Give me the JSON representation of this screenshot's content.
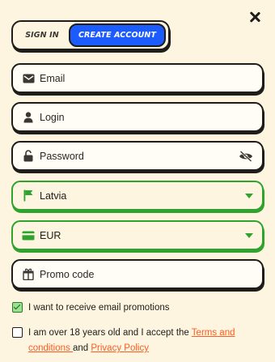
{
  "tabs": {
    "sign_in": "SIGN IN",
    "create_account": "CREATE ACCOUNT",
    "active": "create_account"
  },
  "fields": {
    "email": {
      "placeholder": "Email",
      "icon": "envelope-icon"
    },
    "login": {
      "placeholder": "Login",
      "icon": "user-icon"
    },
    "password": {
      "placeholder": "Password",
      "icon": "lock-icon",
      "toggle_icon": "eye-off-icon"
    },
    "country": {
      "value": "Latvia",
      "icon": "flag-icon"
    },
    "currency": {
      "value": "EUR",
      "icon": "card-icon"
    },
    "promo": {
      "placeholder": "Promo code",
      "icon": "gift-icon"
    }
  },
  "consents": {
    "promotions": {
      "label": "I want to receive email promotions",
      "checked": true
    },
    "terms": {
      "prefix": "I am over 18 years old and I accept the ",
      "terms_link": "Terms and conditions ",
      "middle": "and ",
      "privacy_link": "Privacy Policy",
      "checked": false
    }
  },
  "colors": {
    "background": "#fdf5e0",
    "accent_blue": "#1c5cff",
    "valid_green": "#2ea32e",
    "link_orange": "#ff5a1f"
  }
}
